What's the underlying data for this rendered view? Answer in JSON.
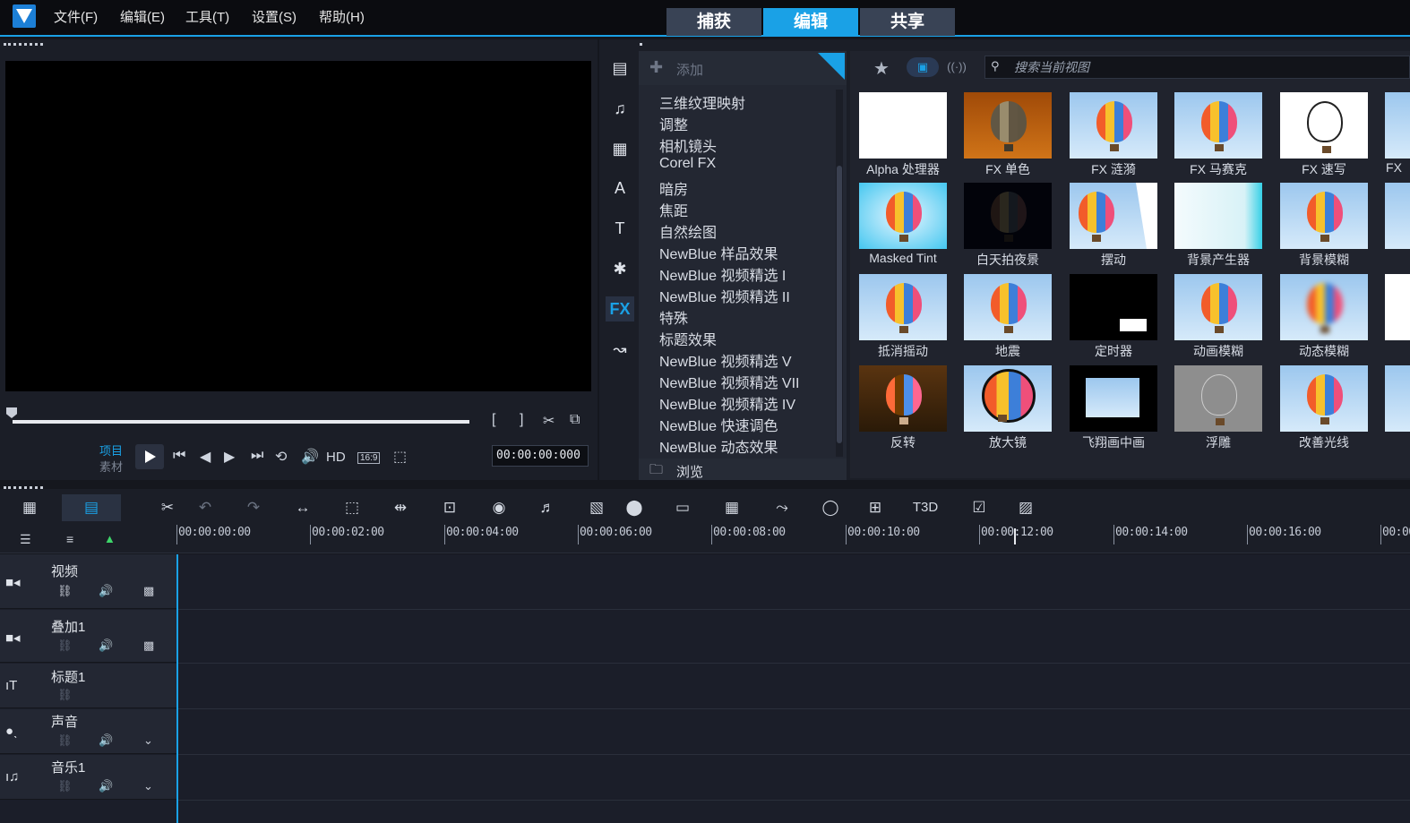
{
  "menu": [
    "文件(F)",
    "编辑(E)",
    "工具(T)",
    "设置(S)",
    "帮助(H)"
  ],
  "modes": {
    "capture": "捕获",
    "edit": "编辑",
    "share": "共享",
    "active": "edit"
  },
  "preview": {
    "project_label": "项目",
    "clip_label": "素材",
    "hd_label": "HD",
    "aspect_label": "16:9",
    "timecode": "00:00:00:000"
  },
  "library": {
    "add_label": "添加",
    "browse_label": "浏览",
    "search_placeholder": "搜索当前视图",
    "fx_tab_label": "FX",
    "categories": [
      "三维纹理映射",
      "调整",
      "相机镜头",
      "Corel FX",
      "暗房",
      "焦距",
      "自然绘图",
      "NewBlue 样品效果",
      "NewBlue 视频精选 I",
      "NewBlue 视频精选 II",
      "特殊",
      "标题效果",
      "NewBlue 视频精选 V",
      "NewBlue 视频精选 VII",
      "NewBlue 视频精选 IV",
      "NewBlue 快速调色",
      "NewBlue 动态效果"
    ],
    "effects": [
      [
        "Alpha 处理器",
        "FX 单色",
        "FX 涟漪",
        "FX 马赛克",
        "FX 速写",
        "FX"
      ],
      [
        "Masked Tint",
        "白天拍夜景",
        "摆动",
        "背景产生器",
        "背景模糊",
        ""
      ],
      [
        "抵消摇动",
        "地震",
        "定时器",
        "动画模糊",
        "动态模糊",
        ""
      ],
      [
        "反转",
        "放大镜",
        "飞翔画中画",
        "浮雕",
        "改善光线",
        ""
      ]
    ]
  },
  "timeline": {
    "ruler": [
      "00:00:00:00",
      "00:00:02:00",
      "00:00:04:00",
      "00:00:06:00",
      "00:00:08:00",
      "00:00:10:00",
      "00:00:12:00",
      "00:00:14:00",
      "00:00:16:00",
      "00:00"
    ],
    "tracks": [
      "视频",
      "叠加1",
      "标题1",
      "声音",
      "音乐1"
    ],
    "tt_label": "T3D"
  },
  "colors": {
    "accent": "#1aa1e6"
  }
}
